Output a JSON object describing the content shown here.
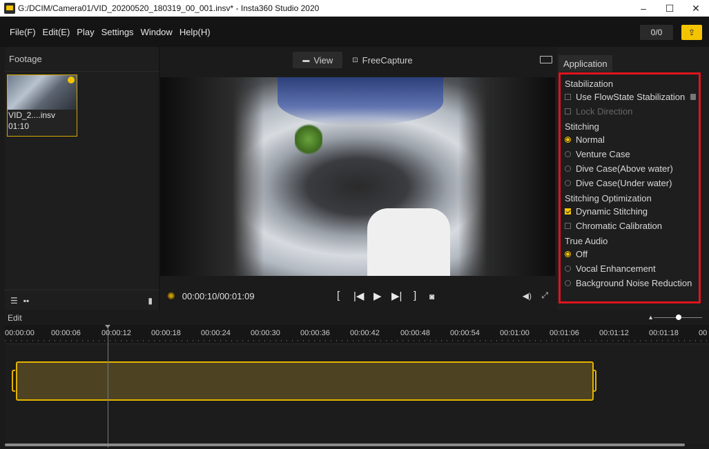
{
  "window": {
    "title": "G:/DCIM/Camera01/VID_20200520_180319_00_001.insv* - Insta360 Studio 2020",
    "controls": {
      "minimize": "–",
      "maximize": "☐",
      "close": "✕"
    }
  },
  "menu": {
    "items": [
      "File(F)",
      "Edit(E)",
      "Play",
      "Settings",
      "Window",
      "Help(H)"
    ],
    "counter": "0/0",
    "upload_icon": "upload-icon"
  },
  "footage": {
    "title": "Footage",
    "clip": {
      "name": "VID_2....insv",
      "duration": "01:10"
    },
    "footer_icons": [
      "list-view-icon",
      "grid-view-icon",
      "trash-icon"
    ]
  },
  "viewer": {
    "tabs": [
      {
        "label": "View",
        "active": true
      },
      {
        "label": "FreeCapture",
        "active": false
      }
    ],
    "timecode": "00:00:10/00:01:09",
    "controls": {
      "mark_in": "[",
      "prev": "|◀",
      "play": "▶",
      "next": "▶|",
      "mark_out": "]"
    }
  },
  "application": {
    "tab_label": "Application",
    "stabilization": {
      "title": "Stabilization",
      "flowstate": {
        "label": "Use FlowState Stabilization",
        "checked": false
      },
      "lock_direction": {
        "label": "Lock Direction",
        "checked": false,
        "disabled": true
      }
    },
    "stitching": {
      "title": "Stitching",
      "options": [
        {
          "label": "Normal",
          "selected": true
        },
        {
          "label": "Venture Case",
          "selected": false
        },
        {
          "label": "Dive Case(Above water)",
          "selected": false
        },
        {
          "label": "Dive Case(Under water)",
          "selected": false
        }
      ]
    },
    "stitching_optimization": {
      "title": "Stitching Optimization",
      "dynamic": {
        "label": "Dynamic Stitching",
        "checked": true
      },
      "chromatic": {
        "label": "Chromatic Calibration",
        "checked": false
      }
    },
    "true_audio": {
      "title": "True Audio",
      "options": [
        {
          "label": "Off",
          "selected": true
        },
        {
          "label": "Vocal Enhancement",
          "selected": false
        },
        {
          "label": "Background Noise Reduction",
          "selected": false
        }
      ]
    },
    "highlight_color": "#e0141d",
    "accent_color": "#f5c400"
  },
  "edit": {
    "title": "Edit",
    "ruler_ticks": [
      "00:00:00",
      "00:00:06",
      "00:00:12",
      "00:00:18",
      "00:00:24",
      "00:00:30",
      "00:00:36",
      "00:00:42",
      "00:00:48",
      "00:00:54",
      "00:01:00",
      "00:01:06",
      "00:01:12",
      "00:01:18",
      "00"
    ]
  }
}
